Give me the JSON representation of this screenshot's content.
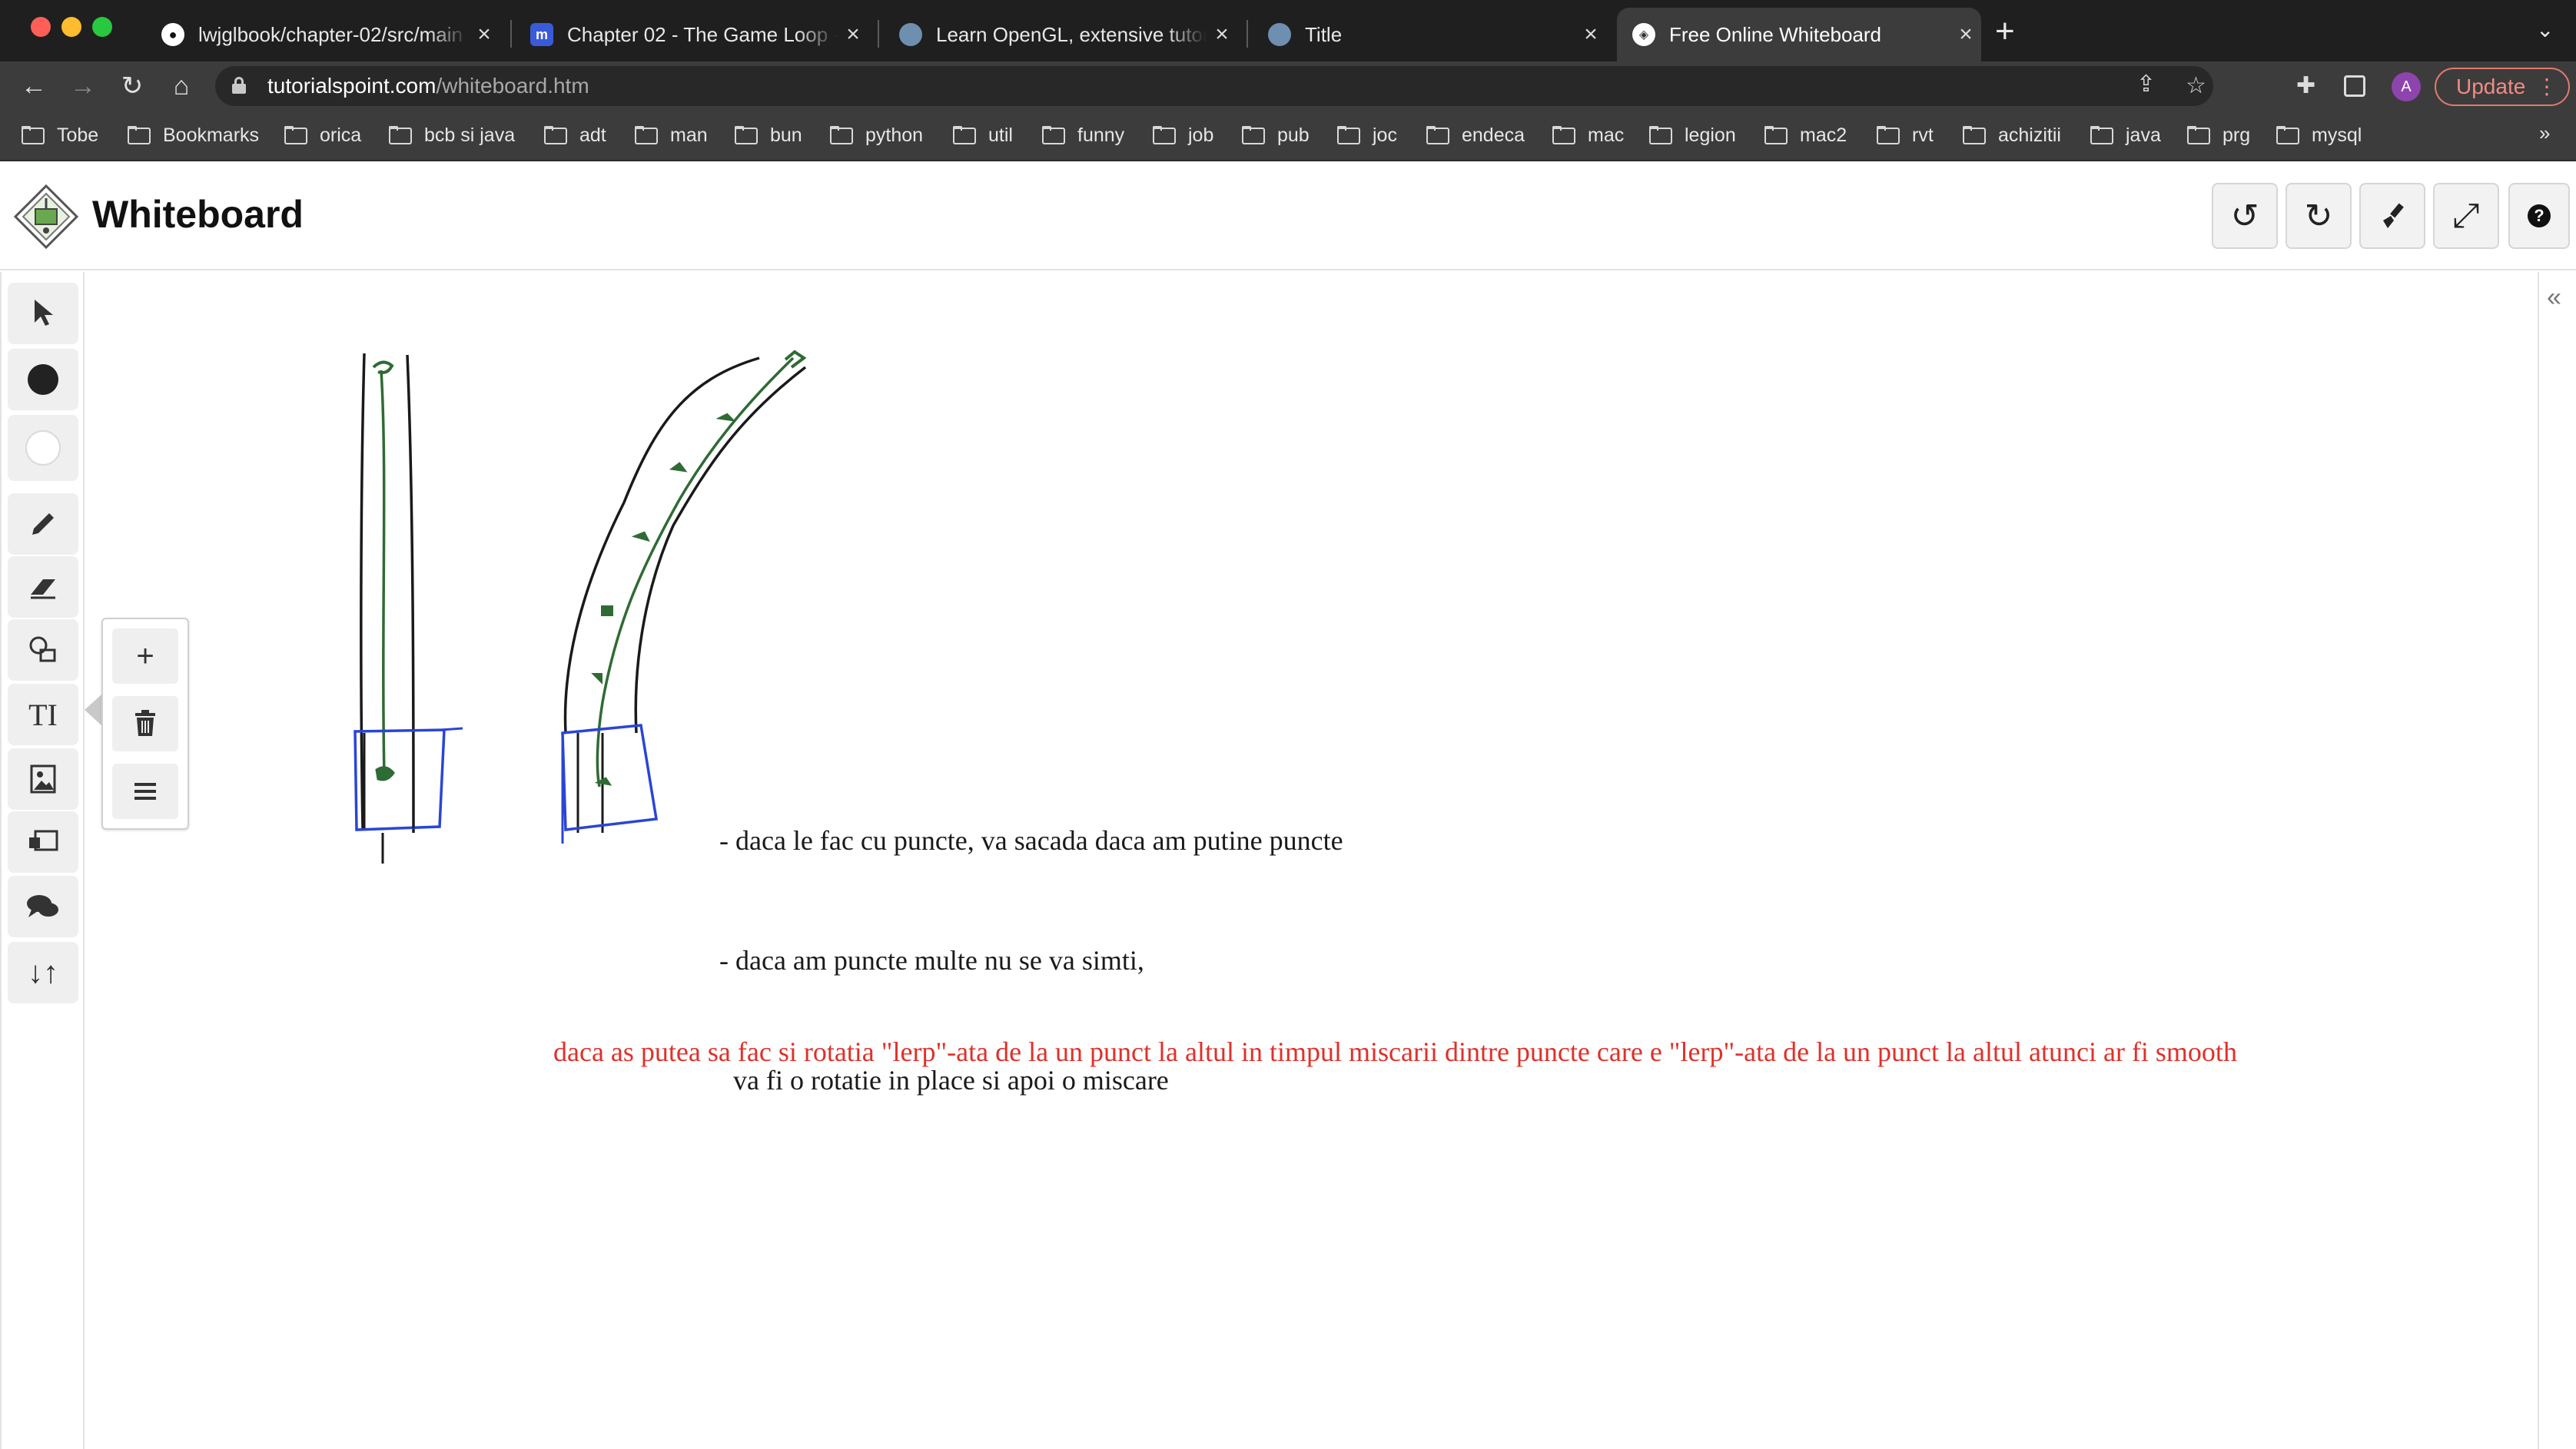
{
  "browser": {
    "tabs": [
      {
        "title": "lwjglbook/chapter-02/src/main",
        "favicon": "github-icon",
        "active": false
      },
      {
        "title": "Chapter 02 - The Game Loop -",
        "favicon": "gitbook-icon",
        "active": false
      },
      {
        "title": "Learn OpenGL, extensive tutori",
        "favicon": "learnopengl-icon",
        "active": false
      },
      {
        "title": "Title",
        "favicon": "learnopengl-icon",
        "active": false
      },
      {
        "title": "Free Online Whiteboard",
        "favicon": "tutorialspoint-icon",
        "active": true
      }
    ],
    "url_domain": "tutorialspoint.com",
    "url_path": "/whiteboard.htm",
    "profile_initial": "A",
    "update_label": "Update",
    "bookmarks": [
      "Tobe",
      "Bookmarks",
      "orica",
      "bcb si java",
      "adt",
      "man",
      "bun",
      "python",
      "util",
      "funny",
      "job",
      "pub",
      "joc",
      "endeca",
      "mac",
      "legion",
      "mac2",
      "rvt",
      "achizitii",
      "java",
      "prg",
      "mysql"
    ],
    "bookmarks_more": "»"
  },
  "app": {
    "title": "Whiteboard",
    "header_buttons": [
      "undo-icon",
      "redo-icon",
      "clear-brush-icon",
      "fullscreen-icon",
      "help-icon"
    ],
    "help_glyph": "?",
    "left_tools": [
      "pointer-icon",
      "black-color-icon",
      "white-color-icon",
      "pencil-icon",
      "eraser-icon",
      "shapes-icon",
      "text-icon",
      "image-icon",
      "sticky-note-icon",
      "comment-icon",
      "sort-icon"
    ],
    "text_tool_glyph": "TI",
    "float_panel": [
      "add-page-icon",
      "delete-page-icon",
      "menu-icon"
    ]
  },
  "canvas": {
    "note_lines": [
      "- daca le fac cu puncte, va sacada daca am putine puncte",
      "- daca am puncte multe nu se va simti,",
      "  va fi o rotatie in place si apoi o miscare"
    ],
    "red_note": "daca as putea sa fac si rotatia \"lerp\"-ata de la un punct la altul in timpul miscarii dintre puncte care e \"lerp\"-ata de la un punct la altul atunci ar fi smooth",
    "colors": {
      "ink_black": "#1a1a1a",
      "ink_green": "#2f6b34",
      "ink_blue": "#2a45d6",
      "ink_red": "#e0302a"
    }
  }
}
